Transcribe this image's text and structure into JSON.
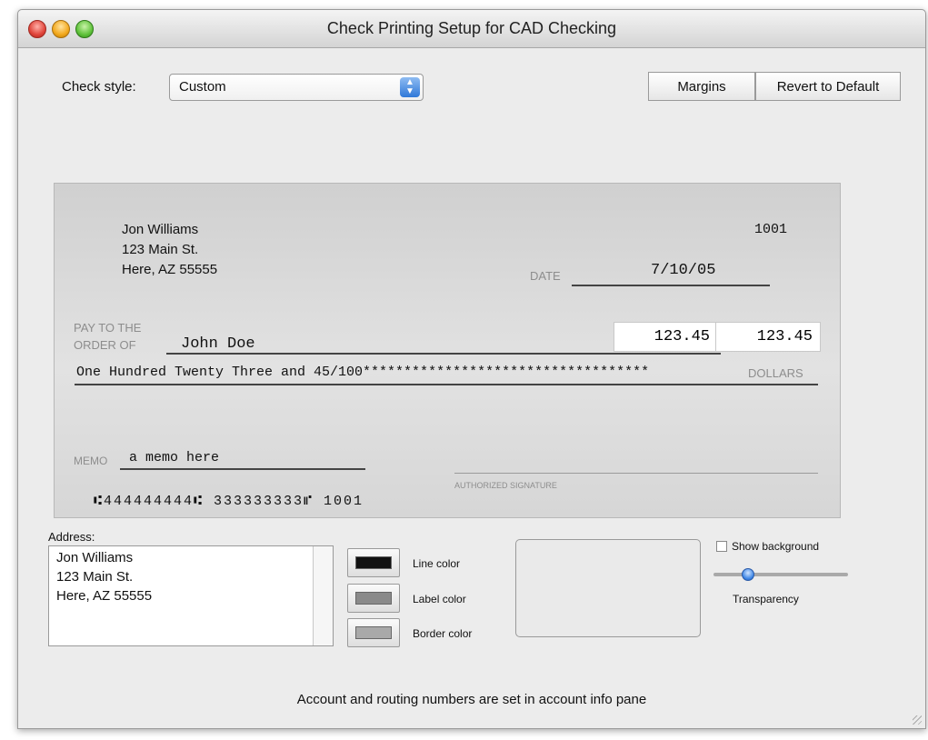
{
  "window": {
    "title": "Check Printing Setup for  CAD Checking"
  },
  "toolbar": {
    "check_style_label": "Check style:",
    "check_style_value": "Custom",
    "margins_label": "Margins",
    "revert_label": "Revert to Default"
  },
  "check": {
    "owner_name": "Jon Williams",
    "owner_street": "123 Main St.",
    "owner_city": "Here, AZ 55555",
    "number": "1001",
    "date_label": "DATE",
    "date_value": "7/10/05",
    "pay_to_label_1": "PAY TO THE",
    "pay_to_label_2": "ORDER OF",
    "payee": "John Doe",
    "amount_numeric": "123.45",
    "amount_numeric_2": "123.45",
    "amount_words": "One Hundred Twenty Three and 45/100***********************************",
    "dollars_label": "DOLLARS",
    "memo_label": "MEMO",
    "memo_value": "a memo here",
    "signature_label": "AUTHORIZED SIGNATURE",
    "micr_line": "⑆444444444⑆ 333333333⑈ 1001"
  },
  "address": {
    "label": "Address:",
    "line1": "Jon Williams",
    "line2": "123 Main St.",
    "line3": "Here, AZ 55555"
  },
  "colors": {
    "line_color_label": "Line color",
    "label_color_label": "Label color",
    "border_color_label": "Border color",
    "line_color": "#111111",
    "label_color": "#8a8a8a",
    "border_color": "#a9a9a9"
  },
  "background": {
    "show_background_label": "Show background",
    "show_background_checked": false,
    "transparency_label": "Transparency",
    "transparency_level": 0.2
  },
  "footer": {
    "note": "Account and routing numbers are set in account info pane"
  }
}
